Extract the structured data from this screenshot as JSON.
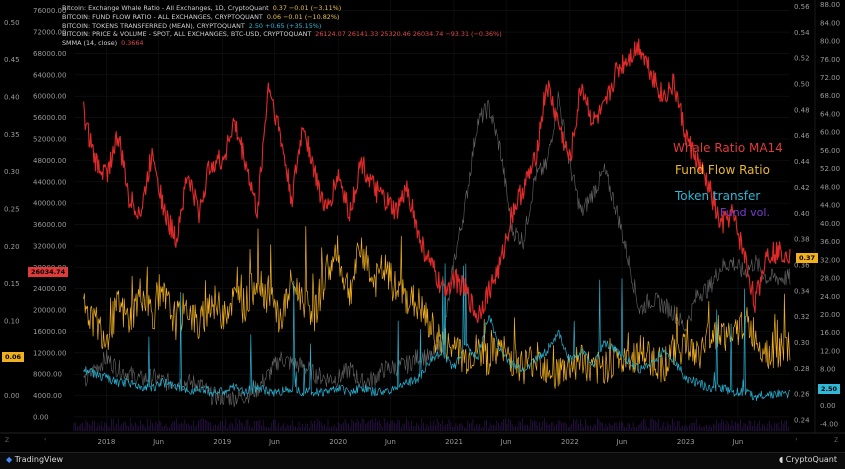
{
  "legend": [
    {
      "label": "Bitcoin: Exchange Whale Ratio - All Exchanges, 1D, CryptoQuant",
      "values": "0.37  −0.01 (−3.11%)",
      "color": "#e8c24a"
    },
    {
      "label": "BITCOIN: FUND FLOW RATIO - ALL EXCHANGES, CRYPTOQUANT",
      "values": "0.06  −0.01 (−10.82%)",
      "color": "#e8c24a"
    },
    {
      "label": "BITCOIN: TOKENS TRANSFERRED (MEAN), CRYPTOQUANT",
      "values": "2.50  +0.65 (+35.15%)",
      "color": "#30b8d8"
    },
    {
      "label": "BITCOIN: PRICE & VOLUME - SPOT, ALL EXCHANGES, BTC-USD, CRYPTOQUANT",
      "values": "26124.07  26141.33  25320.46  26034.74  −93.31 (−0.36%)",
      "color": "#e04a4a"
    },
    {
      "label": "SMMA (14, close)",
      "values": "0.3664",
      "color": "#e04a4a"
    }
  ],
  "annotations": [
    {
      "text": "Whale Ratio MA14",
      "color": "#e03a3a"
    },
    {
      "text": "Fund Flow Ratio",
      "color": "#e8b830"
    },
    {
      "text": "Token transfer",
      "color": "#2fb5d5"
    },
    {
      "text": "Fund vol.",
      "color": "#7a3ad0"
    }
  ],
  "badges": {
    "price": {
      "text": "26034.74",
      "color": "#e03a3a"
    },
    "ffr": {
      "text": "0.06",
      "color": "#f0b020"
    },
    "whale": {
      "text": "0.37",
      "color": "#f0b020"
    },
    "token": {
      "text": "2.50",
      "color": "#30b8d8"
    }
  },
  "footer": {
    "tradingview": "TradingView",
    "cryptoquant": "CryptoQuant"
  },
  "corner_buttons": {
    "left": "Z",
    "left_arrow": "‹",
    "right_arrow": "›",
    "right": "Z"
  },
  "colors": {
    "whale": "#e02a2a",
    "ffr": "#f0b020",
    "token": "#28b0d0",
    "price": "#8a8a8a",
    "volume": "#7a3ad0"
  },
  "chart_data": {
    "type": "line",
    "x_ticks": [
      "2018",
      "Jun",
      "2019",
      "Jun",
      "2020",
      "Jun",
      "2021",
      "Jun",
      "2022",
      "Jun",
      "2023",
      "Jun"
    ],
    "axes": {
      "price_left": {
        "ticks": [
          76000,
          72000,
          68000,
          64000,
          60000,
          56000,
          52000,
          48000,
          44000,
          40000,
          36000,
          32000,
          28000,
          24000,
          20000,
          16000,
          12000,
          8000,
          4000,
          0
        ],
        "range": [
          -3000,
          78000
        ]
      },
      "ffr_left": {
        "ticks": [
          0.5,
          0.45,
          0.4,
          0.35,
          0.3,
          0.25,
          0.2,
          0.15,
          0.1,
          0.05,
          0.0
        ],
        "range": [
          -0.05,
          0.53
        ]
      },
      "whale_right": {
        "ticks": [
          0.56,
          0.54,
          0.52,
          0.5,
          0.48,
          0.46,
          0.44,
          0.42,
          0.4,
          0.38,
          0.36,
          0.34,
          0.32,
          0.3,
          0.28,
          0.26,
          0.24
        ],
        "range": [
          0.23,
          0.565
        ]
      },
      "token_right": {
        "ticks": [
          88,
          84,
          80,
          76,
          72,
          68,
          64,
          60,
          56,
          52,
          48,
          44,
          40,
          36,
          32,
          28,
          24,
          20,
          16,
          12,
          8,
          4,
          0,
          -4
        ],
        "range": [
          -6,
          89
        ]
      }
    },
    "series": [
      {
        "key": "whale",
        "axis": "whale_right",
        "x": [
          2017.8,
          2017.9,
          2018.0,
          2018.1,
          2018.2,
          2018.3,
          2018.4,
          2018.5,
          2018.6,
          2018.7,
          2018.8,
          2018.9,
          2019.0,
          2019.1,
          2019.2,
          2019.3,
          2019.4,
          2019.5,
          2019.6,
          2019.7,
          2019.8,
          2019.9,
          2020.0,
          2020.1,
          2020.2,
          2020.3,
          2020.4,
          2020.5,
          2020.6,
          2020.7,
          2020.8,
          2020.9,
          2021.0,
          2021.1,
          2021.2,
          2021.3,
          2021.4,
          2021.5,
          2021.6,
          2021.7,
          2021.8,
          2021.9,
          2022.0,
          2022.1,
          2022.2,
          2022.3,
          2022.4,
          2022.5,
          2022.6,
          2022.7,
          2022.8,
          2022.9,
          2023.0,
          2023.1,
          2023.2,
          2023.3,
          2023.4,
          2023.5,
          2023.6,
          2023.7
        ],
        "y": [
          0.48,
          0.44,
          0.43,
          0.46,
          0.41,
          0.4,
          0.45,
          0.4,
          0.38,
          0.43,
          0.4,
          0.44,
          0.44,
          0.47,
          0.44,
          0.4,
          0.5,
          0.46,
          0.41,
          0.47,
          0.43,
          0.4,
          0.43,
          0.4,
          0.44,
          0.42,
          0.41,
          0.4,
          0.42,
          0.38,
          0.36,
          0.34,
          0.35,
          0.34,
          0.32,
          0.34,
          0.36,
          0.4,
          0.42,
          0.44,
          0.5,
          0.47,
          0.44,
          0.5,
          0.47,
          0.48,
          0.51,
          0.52,
          0.53,
          0.51,
          0.49,
          0.5,
          0.46,
          0.44,
          0.42,
          0.39,
          0.4,
          0.37,
          0.33,
          0.37
        ]
      },
      {
        "key": "ffr",
        "axis": "ffr_left",
        "x": [
          2017.8,
          2017.9,
          2018.0,
          2018.1,
          2018.2,
          2018.3,
          2018.4,
          2018.5,
          2018.6,
          2018.7,
          2018.8,
          2018.9,
          2019.0,
          2019.1,
          2019.2,
          2019.3,
          2019.4,
          2019.5,
          2019.6,
          2019.7,
          2019.8,
          2019.9,
          2020.0,
          2020.1,
          2020.2,
          2020.3,
          2020.4,
          2020.5,
          2020.6,
          2020.7,
          2020.8,
          2020.9,
          2021.0,
          2021.1,
          2021.2,
          2021.3,
          2021.4,
          2021.5,
          2021.6,
          2021.7,
          2021.8,
          2021.9,
          2022.0,
          2022.1,
          2022.2,
          2022.3,
          2022.4,
          2022.5,
          2022.6,
          2022.7,
          2022.8,
          2022.9,
          2023.0,
          2023.1,
          2023.2,
          2023.3,
          2023.4,
          2023.5,
          2023.6,
          2023.7
        ],
        "y": [
          0.12,
          0.1,
          0.08,
          0.12,
          0.1,
          0.14,
          0.11,
          0.13,
          0.1,
          0.12,
          0.09,
          0.13,
          0.11,
          0.13,
          0.12,
          0.16,
          0.13,
          0.1,
          0.15,
          0.13,
          0.11,
          0.17,
          0.18,
          0.14,
          0.2,
          0.15,
          0.17,
          0.14,
          0.13,
          0.12,
          0.09,
          0.07,
          0.06,
          0.05,
          0.06,
          0.05,
          0.06,
          0.05,
          0.04,
          0.05,
          0.04,
          0.03,
          0.04,
          0.05,
          0.03,
          0.04,
          0.05,
          0.04,
          0.06,
          0.05,
          0.04,
          0.06,
          0.07,
          0.05,
          0.08,
          0.09,
          0.07,
          0.1,
          0.08,
          0.06
        ]
      },
      {
        "key": "token",
        "axis": "token_right",
        "x": [
          2017.8,
          2017.9,
          2018.0,
          2018.1,
          2018.2,
          2018.3,
          2018.4,
          2018.5,
          2018.6,
          2018.7,
          2018.8,
          2018.9,
          2019.0,
          2019.1,
          2019.2,
          2019.3,
          2019.4,
          2019.5,
          2019.6,
          2019.7,
          2019.8,
          2019.9,
          2020.0,
          2020.1,
          2020.2,
          2020.3,
          2020.4,
          2020.5,
          2020.6,
          2020.7,
          2020.8,
          2020.9,
          2021.0,
          2021.1,
          2021.2,
          2021.3,
          2021.4,
          2021.5,
          2021.6,
          2021.7,
          2021.8,
          2021.9,
          2022.0,
          2022.1,
          2022.2,
          2022.3,
          2022.4,
          2022.5,
          2022.6,
          2022.7,
          2022.8,
          2022.9,
          2023.0,
          2023.1,
          2023.2,
          2023.3,
          2023.4,
          2023.5,
          2023.6,
          2023.7
        ],
        "y": [
          8,
          7,
          6,
          5,
          5,
          4,
          4,
          5,
          4,
          3,
          4,
          3,
          3,
          4,
          3,
          4,
          3,
          3,
          4,
          3,
          3,
          3,
          4,
          3,
          4,
          3,
          3,
          4,
          5,
          6,
          10,
          12,
          8,
          14,
          10,
          20,
          12,
          9,
          8,
          10,
          12,
          16,
          10,
          12,
          9,
          14,
          12,
          10,
          8,
          9,
          12,
          10,
          6,
          5,
          4,
          4,
          3,
          3,
          2,
          2.5
        ]
      },
      {
        "key": "price",
        "axis": "price_left",
        "x": [
          2017.8,
          2017.9,
          2018.0,
          2018.1,
          2018.2,
          2018.3,
          2018.4,
          2018.5,
          2018.6,
          2018.7,
          2018.8,
          2018.9,
          2019.0,
          2019.1,
          2019.2,
          2019.3,
          2019.4,
          2019.5,
          2019.6,
          2019.7,
          2019.8,
          2019.9,
          2020.0,
          2020.1,
          2020.2,
          2020.3,
          2020.4,
          2020.5,
          2020.6,
          2020.7,
          2020.8,
          2020.9,
          2021.0,
          2021.1,
          2021.2,
          2021.3,
          2021.4,
          2021.5,
          2021.6,
          2021.7,
          2021.8,
          2021.9,
          2022.0,
          2022.1,
          2022.2,
          2022.3,
          2022.4,
          2022.5,
          2022.6,
          2022.7,
          2022.8,
          2022.9,
          2023.0,
          2023.1,
          2023.2,
          2023.3,
          2023.4,
          2023.5,
          2023.6,
          2023.7
        ],
        "y": [
          6000,
          9000,
          11000,
          9000,
          8000,
          7000,
          7500,
          6500,
          6500,
          6400,
          6300,
          4000,
          3700,
          3600,
          4000,
          5200,
          8000,
          11000,
          10000,
          9500,
          8000,
          7200,
          7200,
          9000,
          6500,
          7000,
          9000,
          9300,
          9800,
          11500,
          11000,
          13500,
          29000,
          40000,
          55000,
          58000,
          50000,
          35000,
          33000,
          45000,
          47000,
          60000,
          47000,
          38000,
          42000,
          46000,
          39000,
          30000,
          20000,
          22000,
          21000,
          19500,
          16500,
          23000,
          24000,
          28000,
          29000,
          27000,
          29000,
          26000
        ]
      }
    ]
  }
}
